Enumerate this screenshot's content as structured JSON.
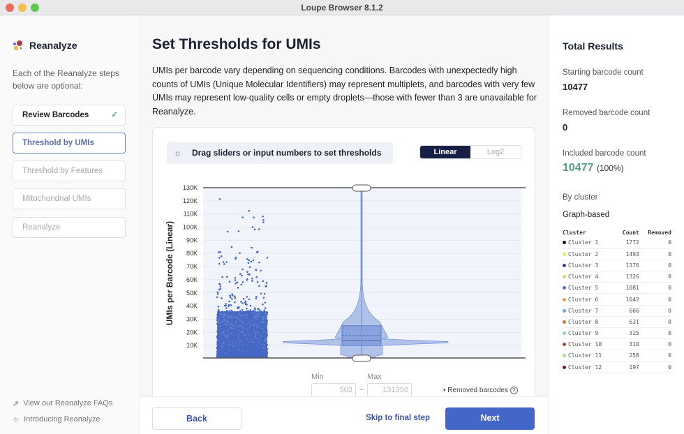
{
  "window": {
    "title": "Loupe Browser 8.1.2"
  },
  "sidebar": {
    "title": "Reanalyze",
    "intro": "Each of the Reanalyze steps below are optional:",
    "steps": [
      {
        "label": "Review Barcodes",
        "state": "done"
      },
      {
        "label": "Threshold by UMIs",
        "state": "active"
      },
      {
        "label": "Threshold by Features",
        "state": "disabled"
      },
      {
        "label": "Mitochondrial UMIs",
        "state": "disabled"
      },
      {
        "label": "Reanalyze",
        "state": "disabled"
      }
    ],
    "links": [
      {
        "label": "View our Reanalyze FAQs",
        "icon": "external-link-icon"
      },
      {
        "label": "Introducing Reanalyze",
        "icon": "lightbulb-icon"
      }
    ]
  },
  "main": {
    "title": "Set Thresholds for UMIs",
    "description": "UMIs per barcode vary depending on sequencing conditions. Barcodes with unexpectedly high counts of UMIs (Unique Molecular Identifiers) may represent multiplets, and barcodes with very few UMIs may represent low-quality cells or empty droplets—those with fewer than 3 are unavailable for Reanalyze.",
    "hint": "Drag sliders or input numbers to set thresholds",
    "scale_toggle": {
      "options": [
        "Linear",
        "Log2"
      ],
      "selected": "Linear"
    },
    "min_label": "Min",
    "max_label": "Max",
    "min_value": "503",
    "max_value": "131350",
    "dash": "–",
    "removed_legend": "Removed barcodes"
  },
  "chart_data": {
    "type": "scatter+violin",
    "ylabel": "UMIs per Barcode (Linear)",
    "yticks": [
      "10K",
      "20K",
      "30K",
      "40K",
      "50K",
      "60K",
      "70K",
      "80K",
      "90K",
      "100K",
      "110K",
      "120K",
      "130K"
    ],
    "ylim": [
      0,
      130000
    ],
    "threshold_min": 503,
    "threshold_max": 131350,
    "point_color": "#4568c4",
    "grid": true
  },
  "footer": {
    "back": "Back",
    "skip": "Skip to final step",
    "next": "Next"
  },
  "results": {
    "title": "Total Results",
    "starting_label": "Starting barcode count",
    "starting": "10477",
    "removed_label": "Removed barcode count",
    "removed": "0",
    "included_label": "Included barcode count",
    "included": "10477",
    "included_pct": "(100%)",
    "by_cluster": "By cluster",
    "graph": "Graph-based",
    "headers": [
      "Cluster",
      "Count",
      "Removed"
    ],
    "clusters": [
      {
        "name": "Cluster 1",
        "count": "1772",
        "removed": "0",
        "color": "#111111"
      },
      {
        "name": "Cluster 2",
        "count": "1493",
        "removed": "0",
        "color": "#e3e86a"
      },
      {
        "name": "Cluster 3",
        "count": "1376",
        "removed": "0",
        "color": "#3b3f9c"
      },
      {
        "name": "Cluster 4",
        "count": "1326",
        "removed": "0",
        "color": "#d8cf7a"
      },
      {
        "name": "Cluster 5",
        "count": "1081",
        "removed": "0",
        "color": "#4a72d8"
      },
      {
        "name": "Cluster 6",
        "count": "1042",
        "removed": "0",
        "color": "#e7a04a"
      },
      {
        "name": "Cluster 7",
        "count": "666",
        "removed": "0",
        "color": "#6fa8dc"
      },
      {
        "name": "Cluster 8",
        "count": "631",
        "removed": "0",
        "color": "#c07a3a"
      },
      {
        "name": "Cluster 9",
        "count": "325",
        "removed": "0",
        "color": "#8fd4b0"
      },
      {
        "name": "Cluster 10",
        "count": "310",
        "removed": "0",
        "color": "#a8432e"
      },
      {
        "name": "Cluster 11",
        "count": "258",
        "removed": "0",
        "color": "#a6e08a"
      },
      {
        "name": "Cluster 12",
        "count": "197",
        "removed": "0",
        "color": "#7a1a22"
      }
    ]
  }
}
